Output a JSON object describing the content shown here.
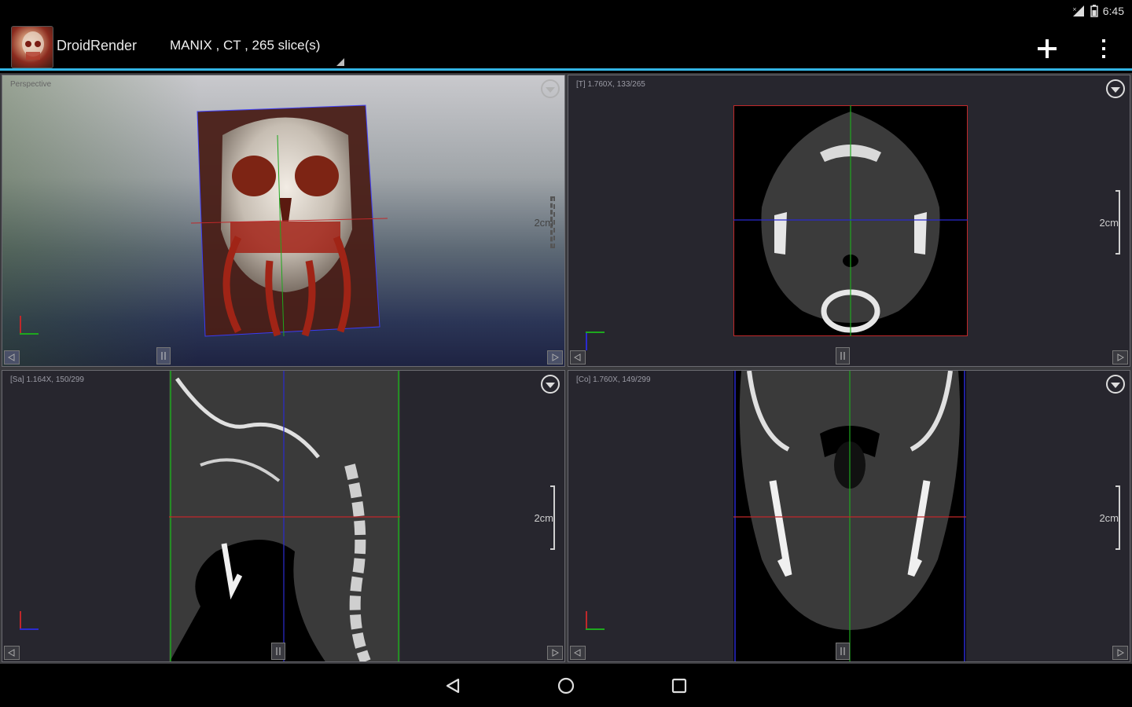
{
  "status_bar": {
    "time": "6:45"
  },
  "action_bar": {
    "app_title": "DroidRender",
    "dataset": "MANIX , CT , 265 slice(s)"
  },
  "viewports": {
    "volume": {
      "info": "Perspective",
      "scale": "2cm"
    },
    "axial": {
      "info": "[T] 1.760X, 133/265",
      "scale": "2cm"
    },
    "sagittal": {
      "info": "[Sa] 1.164X, 150/299",
      "scale": "2cm"
    },
    "coronal": {
      "info": "[Co] 1.760X, 149/299",
      "scale": "2cm"
    }
  },
  "icons": {
    "add": "plus-icon",
    "overflow": "more-vert-icon",
    "viewport_menu": "dropdown-circle-icon",
    "nav_back": "back-triangle-icon",
    "nav_home": "home-circle-icon",
    "nav_recents": "recents-square-icon"
  },
  "colors": {
    "accent": "#33b5e5",
    "cross_red": "#c0282a",
    "cross_green": "#1ea81e",
    "cross_blue": "#2b2bd0"
  }
}
